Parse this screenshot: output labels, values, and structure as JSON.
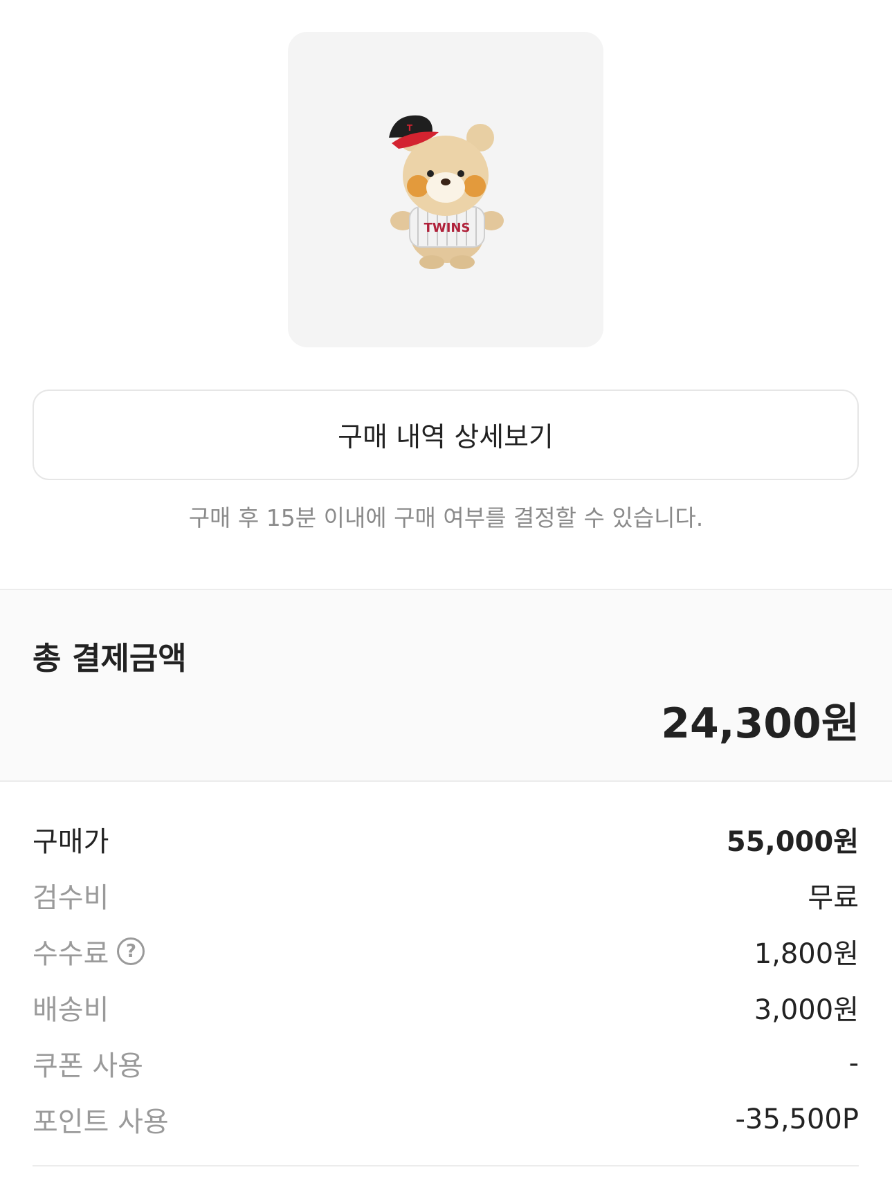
{
  "product": {
    "image_icon": "plush-bear-product-image",
    "jersey_text": "TWINS"
  },
  "detail_button_label": "구매 내역 상세보기",
  "notice": "구매 후 15분 이내에 구매 여부를 결정할 수 있습니다.",
  "total": {
    "label": "총 결제금액",
    "amount": "24,300원"
  },
  "breakdown": [
    {
      "label": "구매가",
      "value": "55,000원"
    },
    {
      "label": "검수비",
      "value": "무료"
    },
    {
      "label": "수수료",
      "value": "1,800원",
      "help_icon": "?"
    },
    {
      "label": "배송비",
      "value": "3,000원"
    },
    {
      "label": "쿠폰 사용",
      "value": "-"
    },
    {
      "label": "포인트 사용",
      "value": "-35,500P"
    }
  ],
  "colors": {
    "background": "#ffffff",
    "panel": "#fafafa",
    "image_bg": "#f4f4f4",
    "text_primary": "#222222",
    "text_secondary": "#9a9a9a",
    "divider": "#ececec"
  }
}
